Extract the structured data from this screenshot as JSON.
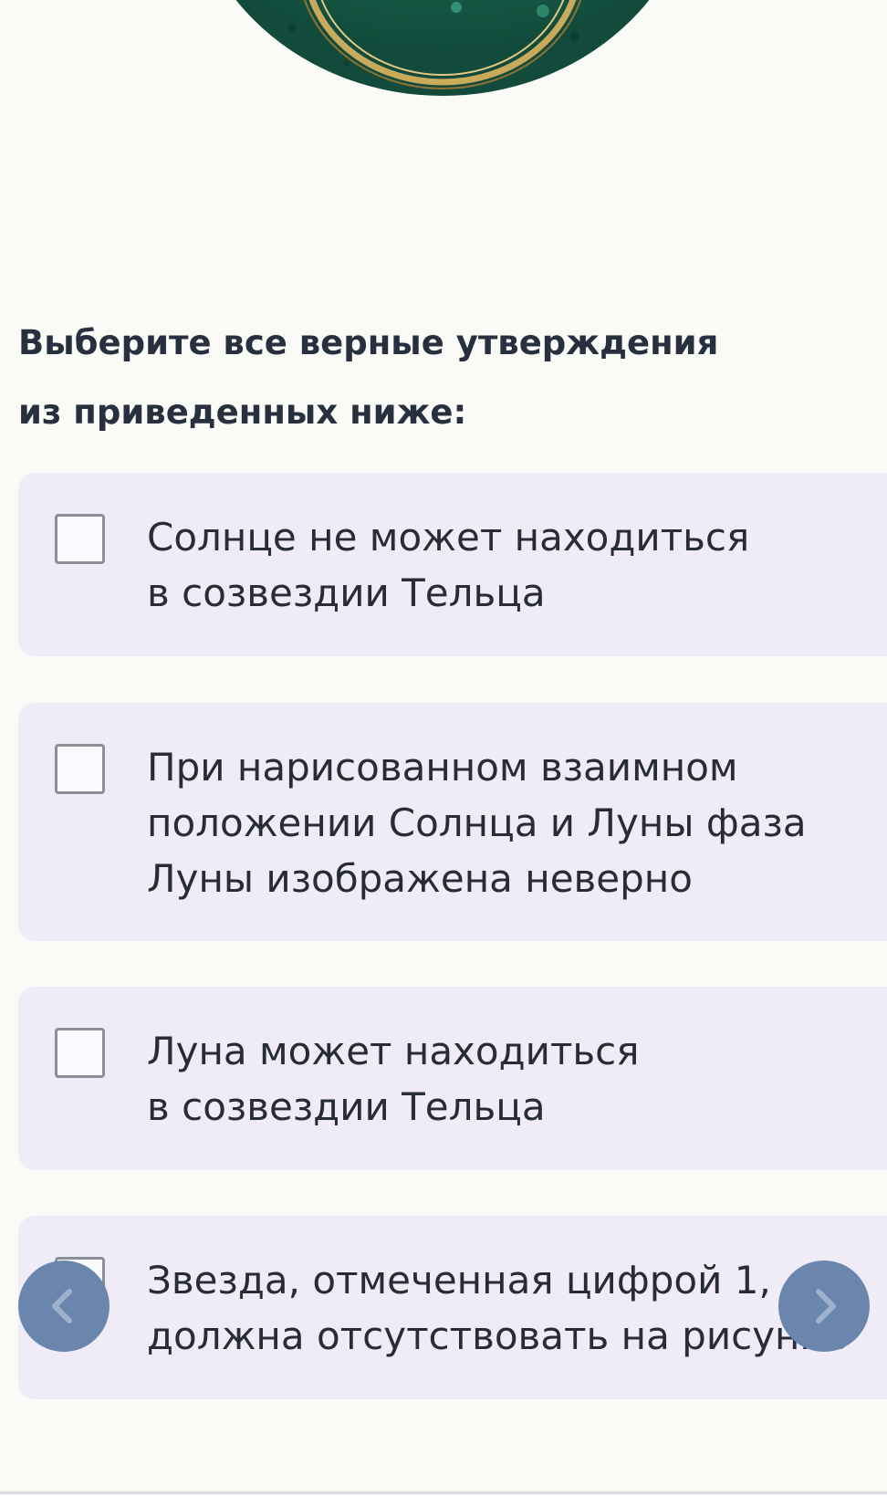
{
  "question": {
    "lines": [
      "Выберите все верные утверждения",
      "из приведенных ниже:"
    ]
  },
  "options": [
    {
      "lines": [
        "Солнце не может находиться",
        "в созвездии Тельца"
      ],
      "checked": false
    },
    {
      "lines": [
        "При нарисованном взаимном",
        "положении Солнца и Луны фаза",
        "Луны изображена неверно"
      ],
      "checked": false
    },
    {
      "lines": [
        "Луна может находиться",
        "в созвездии Тельца"
      ],
      "checked": false
    },
    {
      "lines": [
        "Звезда, отмеченная цифрой 1,",
        "должна отсутствовать на рисунке"
      ],
      "checked": false
    }
  ],
  "navigation": {
    "prev_icon": "chevron-left-icon",
    "next_icon": "chevron-right-icon"
  },
  "colors": {
    "background": "#fafaf6",
    "card": "#efecf8",
    "text": "#272c38",
    "nav_button": "#6a86ac",
    "artifact_green": "#1d6e55",
    "artifact_gold": "#c9a95a"
  }
}
